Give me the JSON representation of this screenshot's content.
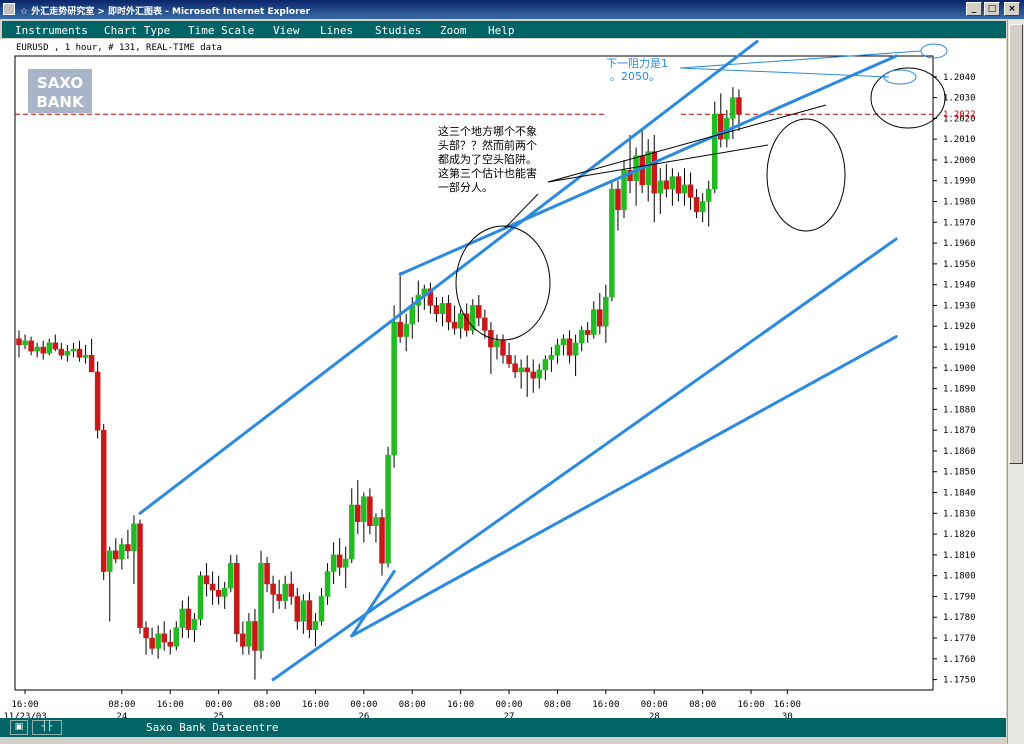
{
  "window": {
    "title": "☆ 外汇走势研究室 > 即时外汇图表 - Microsoft Internet Explorer",
    "buttons": [
      "_",
      "□",
      "×"
    ]
  },
  "menu": [
    "Instruments",
    "Chart Type",
    "Time Scale",
    "View",
    "Lines",
    "Studies",
    "Zoom",
    "Help"
  ],
  "chart_info": "EURUSD , 1 hour, # 131, REAL-TIME data",
  "logo": [
    "SAXO",
    "BANK"
  ],
  "status": {
    "text": "Saxo Bank Datacentre"
  },
  "colors": {
    "up": "#22bb22",
    "down": "#c81818",
    "trendline": "#2a8ae0",
    "band": "#006466",
    "note": "#2a8ae0",
    "price_line": "#cc0000"
  },
  "chart_data": {
    "type": "candlestick",
    "ylim": [
      1.1745,
      1.205
    ],
    "yticks": [
      "1.1750",
      "1.1760",
      "1.1770",
      "1.1780",
      "1.1790",
      "1.1800",
      "1.1810",
      "1.1820",
      "1.1830",
      "1.1840",
      "1.1850",
      "1.1860",
      "1.1870",
      "1.1880",
      "1.1890",
      "1.1900",
      "1.1910",
      "1.1920",
      "1.1930",
      "1.1940",
      "1.1950",
      "1.1960",
      "1.1970",
      "1.1980",
      "1.1990",
      "1.2000",
      "1.2010",
      "1.2020",
      "1.2030",
      "1.2040"
    ],
    "xticks": [
      {
        "bar": 1,
        "time": "16:00",
        "date": "11/23/03"
      },
      {
        "bar": 17,
        "time": "08:00",
        "date": "24"
      },
      {
        "bar": 25,
        "time": "16:00",
        "date": ""
      },
      {
        "bar": 33,
        "time": "00:00",
        "date": "25"
      },
      {
        "bar": 41,
        "time": "08:00",
        "date": ""
      },
      {
        "bar": 49,
        "time": "16:00",
        "date": ""
      },
      {
        "bar": 57,
        "time": "00:00",
        "date": "26"
      },
      {
        "bar": 65,
        "time": "08:00",
        "date": ""
      },
      {
        "bar": 73,
        "time": "16:00",
        "date": ""
      },
      {
        "bar": 81,
        "time": "00:00",
        "date": "27"
      },
      {
        "bar": 89,
        "time": "08:00",
        "date": ""
      },
      {
        "bar": 97,
        "time": "16:00",
        "date": ""
      },
      {
        "bar": 105,
        "time": "00:00",
        "date": "28"
      },
      {
        "bar": 113,
        "time": "08:00",
        "date": ""
      },
      {
        "bar": 121,
        "time": "16:00",
        "date": ""
      },
      {
        "bar": 127,
        "time": "16:00",
        "date": "30"
      }
    ],
    "last_price": "1.2022",
    "candles": [
      [
        1.1914,
        1.1918,
        1.1905,
        1.1911
      ],
      [
        1.1911,
        1.1916,
        1.1909,
        1.1913
      ],
      [
        1.1913,
        1.1915,
        1.1906,
        1.1908
      ],
      [
        1.1908,
        1.1912,
        1.1905,
        1.191
      ],
      [
        1.191,
        1.1913,
        1.1904,
        1.1907
      ],
      [
        1.1907,
        1.1914,
        1.1906,
        1.1912
      ],
      [
        1.1912,
        1.1916,
        1.1908,
        1.1909
      ],
      [
        1.1909,
        1.1912,
        1.1904,
        1.1906
      ],
      [
        1.1906,
        1.1911,
        1.1903,
        1.1908
      ],
      [
        1.1908,
        1.1912,
        1.1905,
        1.1909
      ],
      [
        1.1909,
        1.1913,
        1.1903,
        1.1905
      ],
      [
        1.1905,
        1.1911,
        1.1902,
        1.1906
      ],
      [
        1.1906,
        1.1914,
        1.19,
        1.1898
      ],
      [
        1.1898,
        1.1903,
        1.1866,
        1.187
      ],
      [
        1.187,
        1.1873,
        1.1798,
        1.1802
      ],
      [
        1.1802,
        1.1814,
        1.1778,
        1.1812
      ],
      [
        1.1812,
        1.1818,
        1.1806,
        1.1808
      ],
      [
        1.1808,
        1.1818,
        1.1803,
        1.1815
      ],
      [
        1.1815,
        1.1822,
        1.1808,
        1.1812
      ],
      [
        1.1812,
        1.1829,
        1.1796,
        1.1825
      ],
      [
        1.1825,
        1.1827,
        1.1772,
        1.1775
      ],
      [
        1.1775,
        1.1778,
        1.1762,
        1.177
      ],
      [
        1.177,
        1.1775,
        1.1762,
        1.1765
      ],
      [
        1.1765,
        1.1776,
        1.176,
        1.1772
      ],
      [
        1.1772,
        1.1778,
        1.1764,
        1.1768
      ],
      [
        1.1768,
        1.1774,
        1.1762,
        1.1766
      ],
      [
        1.1766,
        1.1778,
        1.1764,
        1.1775
      ],
      [
        1.1775,
        1.1788,
        1.177,
        1.1784
      ],
      [
        1.1784,
        1.179,
        1.177,
        1.1774
      ],
      [
        1.1774,
        1.1782,
        1.1768,
        1.1779
      ],
      [
        1.1779,
        1.1802,
        1.1776,
        1.18
      ],
      [
        1.18,
        1.1806,
        1.179,
        1.1796
      ],
      [
        1.1796,
        1.1802,
        1.1786,
        1.1793
      ],
      [
        1.1793,
        1.18,
        1.1786,
        1.179
      ],
      [
        1.179,
        1.1797,
        1.1784,
        1.1794
      ],
      [
        1.1794,
        1.181,
        1.1792,
        1.1806
      ],
      [
        1.1806,
        1.181,
        1.1768,
        1.1772
      ],
      [
        1.1772,
        1.1778,
        1.1762,
        1.1766
      ],
      [
        1.1766,
        1.1782,
        1.1762,
        1.1778
      ],
      [
        1.1778,
        1.1784,
        1.175,
        1.1764
      ],
      [
        1.1764,
        1.1812,
        1.176,
        1.1806
      ],
      [
        1.1806,
        1.1809,
        1.1792,
        1.1796
      ],
      [
        1.1796,
        1.18,
        1.1782,
        1.1791
      ],
      [
        1.1791,
        1.1798,
        1.1784,
        1.1788
      ],
      [
        1.1788,
        1.18,
        1.1784,
        1.1796
      ],
      [
        1.1796,
        1.1802,
        1.1786,
        1.179
      ],
      [
        1.179,
        1.1794,
        1.1774,
        1.1778
      ],
      [
        1.1778,
        1.1791,
        1.1772,
        1.1788
      ],
      [
        1.1788,
        1.1792,
        1.177,
        1.1774
      ],
      [
        1.1774,
        1.1782,
        1.1766,
        1.1778
      ],
      [
        1.1778,
        1.1794,
        1.1776,
        1.179
      ],
      [
        1.179,
        1.1806,
        1.1786,
        1.1802
      ],
      [
        1.1802,
        1.1816,
        1.1796,
        1.181
      ],
      [
        1.181,
        1.1818,
        1.18,
        1.1804
      ],
      [
        1.1804,
        1.1814,
        1.1794,
        1.1808
      ],
      [
        1.1808,
        1.1842,
        1.1806,
        1.1834
      ],
      [
        1.1834,
        1.1846,
        1.182,
        1.1826
      ],
      [
        1.1826,
        1.184,
        1.1816,
        1.1838
      ],
      [
        1.1838,
        1.1842,
        1.182,
        1.1824
      ],
      [
        1.1824,
        1.183,
        1.1816,
        1.1828
      ],
      [
        1.1828,
        1.1832,
        1.18,
        1.1806
      ],
      [
        1.1806,
        1.1862,
        1.1804,
        1.1858
      ],
      [
        1.1858,
        1.193,
        1.1852,
        1.1922
      ],
      [
        1.1922,
        1.1946,
        1.1912,
        1.1915
      ],
      [
        1.1915,
        1.1926,
        1.1908,
        1.1921
      ],
      [
        1.1921,
        1.1934,
        1.1914,
        1.193
      ],
      [
        1.193,
        1.1942,
        1.1922,
        1.1935
      ],
      [
        1.1935,
        1.194,
        1.1928,
        1.1938
      ],
      [
        1.1938,
        1.1941,
        1.1926,
        1.193
      ],
      [
        1.193,
        1.1934,
        1.1922,
        1.1926
      ],
      [
        1.1926,
        1.1934,
        1.192,
        1.1931
      ],
      [
        1.1931,
        1.1935,
        1.1918,
        1.1922
      ],
      [
        1.1922,
        1.193,
        1.1916,
        1.1919
      ],
      [
        1.1919,
        1.1928,
        1.1914,
        1.1926
      ],
      [
        1.1926,
        1.1931,
        1.1915,
        1.1918
      ],
      [
        1.1918,
        1.1933,
        1.1916,
        1.193
      ],
      [
        1.193,
        1.1935,
        1.192,
        1.1924
      ],
      [
        1.1924,
        1.1928,
        1.1914,
        1.1918
      ],
      [
        1.1918,
        1.1922,
        1.1897,
        1.191
      ],
      [
        1.191,
        1.1916,
        1.1904,
        1.1913
      ],
      [
        1.1913,
        1.1916,
        1.1902,
        1.1906
      ],
      [
        1.1906,
        1.1912,
        1.19,
        1.1902
      ],
      [
        1.1902,
        1.1906,
        1.1895,
        1.1898
      ],
      [
        1.1898,
        1.1904,
        1.189,
        1.19
      ],
      [
        1.19,
        1.1906,
        1.1886,
        1.1898
      ],
      [
        1.1898,
        1.1904,
        1.1888,
        1.1895
      ],
      [
        1.1895,
        1.1902,
        1.189,
        1.1899
      ],
      [
        1.1899,
        1.1906,
        1.1894,
        1.1904
      ],
      [
        1.1904,
        1.191,
        1.1898,
        1.1906
      ],
      [
        1.1906,
        1.1914,
        1.1902,
        1.1911
      ],
      [
        1.1911,
        1.1916,
        1.1906,
        1.1914
      ],
      [
        1.1914,
        1.1918,
        1.1902,
        1.1906
      ],
      [
        1.1906,
        1.1916,
        1.1896,
        1.1912
      ],
      [
        1.1912,
        1.192,
        1.1908,
        1.1918
      ],
      [
        1.1918,
        1.1922,
        1.1912,
        1.1916
      ],
      [
        1.1916,
        1.1932,
        1.1914,
        1.1928
      ],
      [
        1.1928,
        1.1936,
        1.1916,
        1.192
      ],
      [
        1.192,
        1.194,
        1.1912,
        1.1934
      ],
      [
        1.1934,
        1.199,
        1.1932,
        1.1986
      ],
      [
        1.1986,
        1.199,
        1.1966,
        1.1976
      ],
      [
        1.1976,
        1.2,
        1.1972,
        1.1995
      ],
      [
        1.1995,
        1.2012,
        1.1984,
        1.199
      ],
      [
        1.199,
        1.2006,
        1.1978,
        1.2002
      ],
      [
        1.2002,
        1.2014,
        1.1984,
        1.1988
      ],
      [
        1.1988,
        1.201,
        1.198,
        1.2004
      ],
      [
        1.2004,
        1.2012,
        1.197,
        1.1984
      ],
      [
        1.1984,
        1.1996,
        1.1974,
        1.199
      ],
      [
        1.199,
        1.1998,
        1.1982,
        1.1986
      ],
      [
        1.1986,
        1.1996,
        1.1978,
        1.1992
      ],
      [
        1.1992,
        1.1994,
        1.198,
        1.1984
      ],
      [
        1.1984,
        1.1996,
        1.1978,
        1.1988
      ],
      [
        1.1988,
        1.1994,
        1.1976,
        1.1982
      ],
      [
        1.1982,
        1.1986,
        1.1972,
        1.1975
      ],
      [
        1.1975,
        1.1984,
        1.197,
        1.198
      ],
      [
        1.198,
        1.199,
        1.1968,
        1.1986
      ],
      [
        1.1986,
        1.2028,
        1.1984,
        1.2022
      ],
      [
        1.2022,
        1.2032,
        1.2006,
        1.201
      ],
      [
        1.201,
        1.2024,
        1.2006,
        1.202
      ],
      [
        1.202,
        1.2035,
        1.201,
        1.203
      ],
      [
        1.203,
        1.2034,
        1.2014,
        1.2022
      ]
    ],
    "trendlines": [
      {
        "name": "resistance-outer",
        "from": [
          20,
          1.183
        ],
        "to": [
          122,
          1.2057
        ]
      },
      {
        "name": "resistance-inner",
        "from": [
          63,
          1.1945
        ],
        "to": [
          145,
          1.205
        ]
      },
      {
        "name": "support-steep",
        "from": [
          42,
          1.175
        ],
        "to": [
          145,
          1.1962
        ]
      },
      {
        "name": "support-shallow",
        "from": [
          55,
          1.1771
        ],
        "to": [
          145,
          1.1915
        ]
      },
      {
        "name": "connector",
        "from": [
          55,
          1.1771
        ],
        "to": [
          62,
          1.1802
        ]
      }
    ],
    "resistance_level": 1.2022,
    "annotations": {
      "note1": [
        "这三个地方哪个不象",
        "头部？？然而前两个",
        "都成为了空头陷阱。",
        "这第三个估计也能害",
        "一部分人。"
      ],
      "note2": [
        "下一阻力是1",
        "。2050。"
      ]
    }
  }
}
